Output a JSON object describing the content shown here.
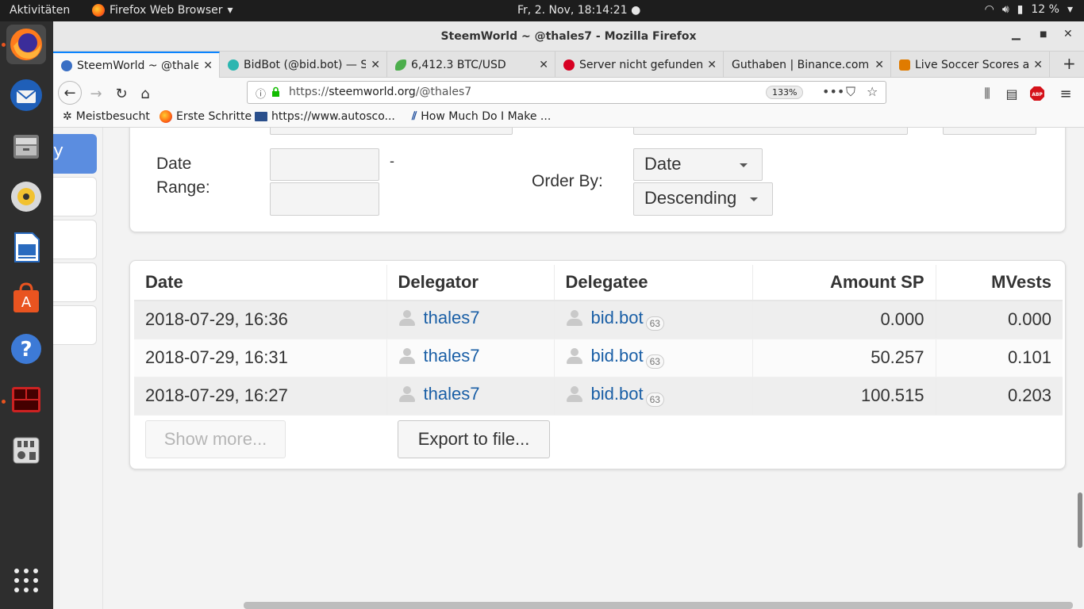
{
  "topbar": {
    "activities": "Aktivitäten",
    "app_name": "Firefox Web Browser",
    "clock": "Fr,  2. Nov, 18:14:21",
    "battery": "12 %"
  },
  "dock": {
    "items": [
      "firefox-icon",
      "thunderbird-icon",
      "files-icon",
      "rhythmbox-icon",
      "writer-icon",
      "software-icon",
      "help-icon",
      "terminal-icon",
      "usb-icon",
      "apps-grid-icon"
    ]
  },
  "window": {
    "title": "SteemWorld ~ @thales7 - Mozilla Firefox"
  },
  "tabs": [
    {
      "label": "SteemWorld ~ @thale",
      "color": "#3a6fc4"
    },
    {
      "label": "BidBot (@bid.bot) — S",
      "color": "#2bb6b0"
    },
    {
      "label": "6,412.3 BTC/USD",
      "color": "#4cae4c"
    },
    {
      "label": "Server nicht gefunden",
      "color": "#d70022"
    },
    {
      "label": "Guthaben | Binance.com",
      "color": ""
    },
    {
      "label": "Live Soccer Scores and",
      "color": "#e07b00"
    }
  ],
  "urlbar": {
    "prefix": "https://",
    "domain": "steemworld.org",
    "path": "/@thales7",
    "zoom": "133%"
  },
  "bookmarks": [
    "Meistbesucht",
    "Erste Schritte",
    "https://www.autosco...",
    "How Much Do I Make ..."
  ],
  "filters": {
    "date_range_label_1": "Date",
    "date_range_label_2": "Range:",
    "dash": "-",
    "order_by_label": "Order By:",
    "order_field": "Date",
    "order_dir": "Descending"
  },
  "nav": {
    "active_fragment": "y"
  },
  "table": {
    "headers": [
      "Date",
      "Delegator",
      "Delegatee",
      "Amount SP",
      "MVests"
    ],
    "rows": [
      {
        "date": "2018-07-29, 16:36",
        "delegator": "thales7",
        "delegatee": "bid.bot",
        "rep": "63",
        "sp": "0.000",
        "mvests": "0.000"
      },
      {
        "date": "2018-07-29, 16:31",
        "delegator": "thales7",
        "delegatee": "bid.bot",
        "rep": "63",
        "sp": "50.257",
        "mvests": "0.101"
      },
      {
        "date": "2018-07-29, 16:27",
        "delegator": "thales7",
        "delegatee": "bid.bot",
        "rep": "63",
        "sp": "100.515",
        "mvests": "0.203"
      }
    ]
  },
  "buttons": {
    "show_more": "Show more...",
    "export": "Export to file..."
  },
  "colors": {
    "accent": "#0a84ff",
    "link": "#1a5fa6",
    "nav_active": "#5b8de0"
  }
}
